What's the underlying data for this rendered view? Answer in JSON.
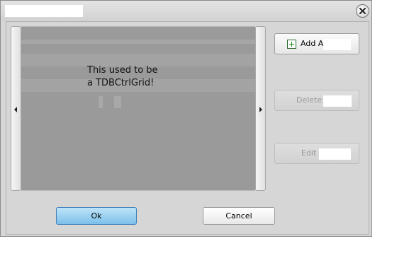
{
  "dialog": {
    "title": ""
  },
  "grid": {
    "placeholder_line1": "This used to be",
    "placeholder_line2": "a TDBCtrlGrid!"
  },
  "buttons": {
    "add_label": "Add A",
    "delete_label": "Delete A",
    "edit_label": "Edit",
    "ok_label": "Ok",
    "cancel_label": "Cancel"
  },
  "colors": {
    "grid_bg": "#9a9a9a",
    "ok_accent": "#7cc0eb",
    "dialog_bg": "#d6d6d6"
  },
  "icons": {
    "close": "close-icon",
    "add": "add-record-icon",
    "prev": "left-arrow-icon",
    "next": "right-arrow-icon"
  }
}
